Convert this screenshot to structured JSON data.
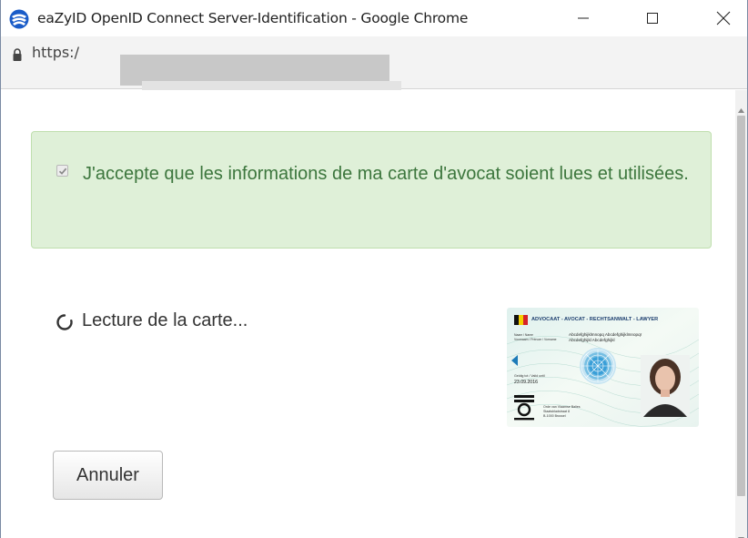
{
  "window": {
    "title": "eaZyID OpenID Connect Server-Identification - Google Chrome",
    "app_icon": "chrome-app-icon",
    "controls": {
      "minimize": "minimize-icon",
      "maximize": "maximize-icon",
      "close": "close-icon"
    }
  },
  "address_bar": {
    "lock_icon": "lock-icon",
    "url": "https:/"
  },
  "alert": {
    "checked": true,
    "text": "J'accepte que les informations de ma carte d'avocat soient lues et utilisées.",
    "colors": {
      "background": "#dff0d8",
      "border": "#bfdfae",
      "text": "#3c763d"
    }
  },
  "status": {
    "icon": "spinner-icon",
    "text": "Lecture de la carte..."
  },
  "card": {
    "header": "ADVOCAAT - AVOCAT - RECHTSANWALT - LAWYER",
    "name_label": "Naam / Name",
    "firstname_label": "Voornaam / Prénom / Vorname",
    "name_value": "Abcdefghijklmnopq Abcdefghijklmnopqr",
    "firstname_value": "Abcdefghijkl Abcdefghijkl",
    "validity_label": "Geldig tot / Valid until",
    "validity_value": "23.09.2016",
    "issuer_line1": "Orde van Vlaamse Balies",
    "issuer_line2": "Staatsbladstraat 8",
    "issuer_line3": "B-1000 Brussel"
  },
  "actions": {
    "cancel_label": "Annuler"
  },
  "scrollbar": {
    "up": "scroll-up-arrow-icon",
    "down": "scroll-down-arrow-icon"
  }
}
